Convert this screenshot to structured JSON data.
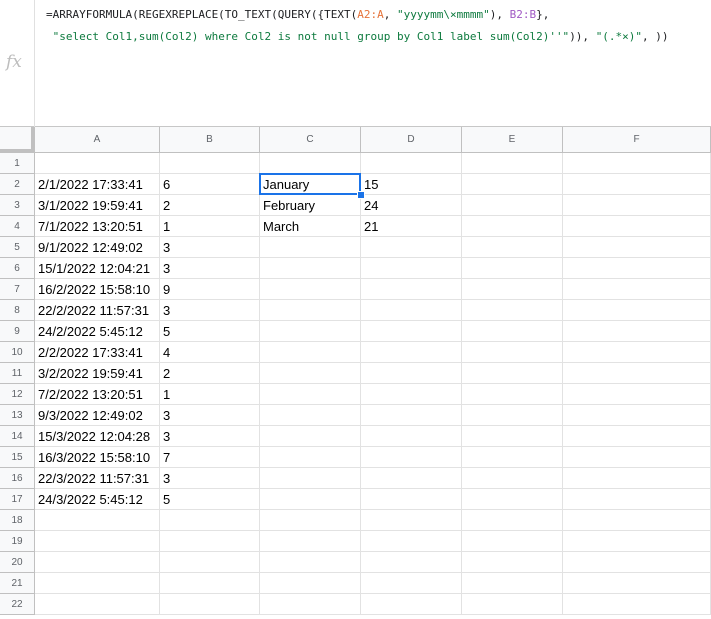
{
  "formula_bar": {
    "fx_label": "fx",
    "line1": {
      "p1": "=ARRAYFORMULA(REGEXREPLACE(TO_TEXT(QUERY({TEXT(",
      "ref_a": "A2:A",
      "p2": ", ",
      "str1": "\"yyyymm\\×mmmm\"",
      "p3": "), ",
      "ref_b": "B2:B",
      "p4": "},"
    },
    "line2": {
      "p1": " ",
      "str1": "\"select Col1,sum(Col2) where Col2 is not null group by Col1 label sum(Col2)''\"",
      "p2": ")), ",
      "str2": "\"(.*×)\"",
      "p3": ", ))"
    }
  },
  "columns": [
    "A",
    "B",
    "C",
    "D",
    "E",
    "F"
  ],
  "rows": [
    "1",
    "2",
    "3",
    "4",
    "5",
    "6",
    "7",
    "8",
    "9",
    "10",
    "11",
    "12",
    "13",
    "14",
    "15",
    "16",
    "17",
    "18",
    "19",
    "20",
    "21",
    "22"
  ],
  "cells": {
    "A": [
      "",
      "2/1/2022 17:33:41",
      "3/1/2022 19:59:41",
      "7/1/2022 13:20:51",
      "9/1/2022 12:49:02",
      "15/1/2022 12:04:21",
      "16/2/2022 15:58:10",
      "22/2/2022 11:57:31",
      "24/2/2022 5:45:12",
      "2/2/2022 17:33:41",
      "3/2/2022 19:59:41",
      "7/2/2022 13:20:51",
      "9/3/2022 12:49:02",
      "15/3/2022 12:04:28",
      "16/3/2022 15:58:10",
      "22/3/2022 11:57:31",
      "24/3/2022 5:45:12"
    ],
    "B": [
      "",
      "6",
      "2",
      "1",
      "3",
      "3",
      "9",
      "3",
      "5",
      "4",
      "2",
      "1",
      "3",
      "3",
      "7",
      "3",
      "5"
    ],
    "C": [
      "",
      "January",
      "February",
      "March"
    ],
    "D": [
      "",
      "15",
      "24",
      "21"
    ]
  },
  "selection": {
    "cell": "C2"
  },
  "colors": {
    "selection": "#1a73e8",
    "header_bg": "#f8f9fa",
    "gridline": "#e2e2e2"
  }
}
